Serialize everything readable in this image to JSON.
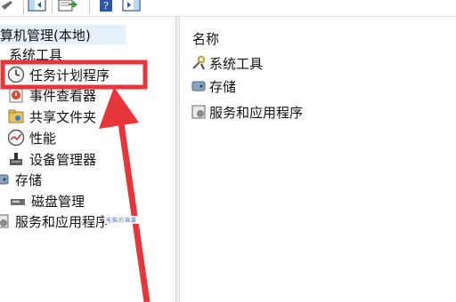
{
  "toolbar": {
    "buttons": [
      "properties-icon",
      "show-hide-tree-icon",
      "export-list-icon",
      "help-icon",
      "show-action-pane-icon"
    ]
  },
  "tree": {
    "root": "算机管理(本地)",
    "system_tools": "系统工具",
    "items": [
      {
        "label": "任务计划程序",
        "icon": "clock-icon"
      },
      {
        "label": "事件查看器",
        "icon": "event-viewer-icon"
      },
      {
        "label": "共享文件夹",
        "icon": "shared-folder-icon"
      },
      {
        "label": "性能",
        "icon": "performance-icon"
      },
      {
        "label": "设备管理器",
        "icon": "device-manager-icon"
      }
    ],
    "storage": "存储",
    "disk_management": "磁盘管理",
    "services": "服务和应用程序"
  },
  "right": {
    "column_header": "名称",
    "items": [
      {
        "label": "系统工具",
        "icon": "tools-icon"
      },
      {
        "label": "存储",
        "icon": "storage-icon"
      },
      {
        "label": "服务和应用程序",
        "icon": "services-icon"
      }
    ]
  },
  "annotation": {
    "highlight_color": "#e8353a",
    "watermark": "电脑的锦囊"
  }
}
